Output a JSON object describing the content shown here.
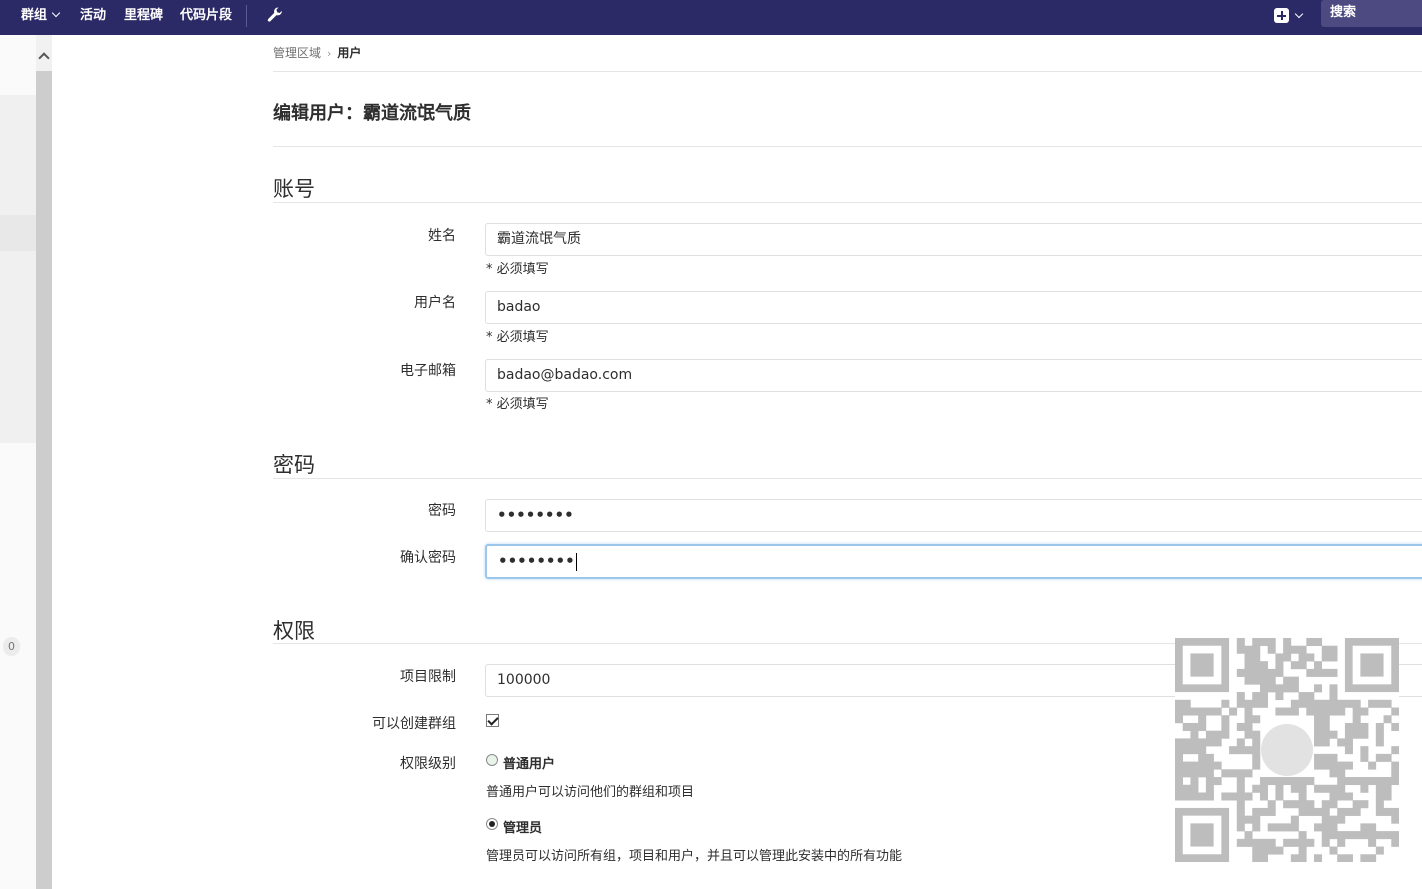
{
  "nav": {
    "items": [
      {
        "label": "群组",
        "has_dropdown": true
      },
      {
        "label": "活动"
      },
      {
        "label": "里程碑"
      },
      {
        "label": "代码片段"
      }
    ],
    "admin_icon": "wrench-icon",
    "new_icon": "plus-square-icon",
    "search_label": "搜索"
  },
  "sidebar": {
    "collapse_icon": "chevron-up-icon",
    "badge_count": "0"
  },
  "breadcrumb": {
    "parent": "管理区域",
    "separator": "›",
    "current": "用户"
  },
  "page_title": "编辑用户：霸道流氓气质",
  "sections": {
    "account": {
      "title": "账号",
      "name_label": "姓名",
      "name_value": "霸道流氓气质",
      "username_label": "用户名",
      "username_value": "badao",
      "email_label": "电子邮箱",
      "email_value": "badao@badao.com",
      "required_hint": "* 必须填写"
    },
    "password": {
      "title": "密码",
      "password_label": "密码",
      "password_value": "••••••••",
      "confirm_label": "确认密码",
      "confirm_value": "••••••••"
    },
    "permissions": {
      "title": "权限",
      "project_limit_label": "项目限制",
      "project_limit_value": "100000",
      "can_create_group_label": "可以创建群组",
      "can_create_group_checked": true,
      "access_level_label": "权限级别",
      "levels": [
        {
          "label": "普通用户",
          "description": "普通用户可以访问他们的群组和项目",
          "selected": false
        },
        {
          "label": "管理员",
          "description": "管理员可以访问所有组，项目和用户，并且可以管理此安装中的所有功能",
          "selected": true
        }
      ]
    }
  },
  "colors": {
    "topbar": "#2b2966",
    "search_bg": "#4c4a80",
    "focus_border": "#9cc7ea"
  }
}
